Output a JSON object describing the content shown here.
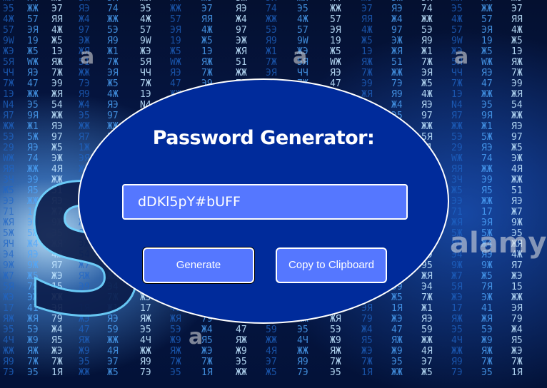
{
  "background": {
    "matrix_columns": [
      "ЖИ\nЭ5\n4Ж\n57\n9W\nЖЭ\n5Я\nЧЧ\n7Ж\n1Э\nN4\nЯ7\nЖЖ\n5Э\n29\nWЖ\nЯЯ\n3Ч\nЖ5\nЭЭ\n71\nЖЯ\n5Ж\nЯЧ\nЭ4\n9Ж\nЖ7\n5Я\nЖЭ\n17\nЯЖ\nЭ5\n4Ч\nЖЖ\nЯ9\n7Э",
      "Я4\nЖЖ\n57\nЭЯ\n19\nЖ5\nWЖ\nЯЭ\n47\nЖЖ\nЭ5\n9Я\nЖ1\n5Ж\nЯЭ\n74\nЖЖ\nЭ9\nЯ5\nЖЖ\n17\nЭЯ\n5Ж\nЖ4\nЯЭ\n9Ж\nЖ5\n7Я\nЭЖ\n41\nЖЯ\n5Э\nЖ9\nЯЖ\n7Ж\nЭ5",
      "Ж9\nЭ7\nЯЯ\n4Ж\nЖ5\n1Э\nЯЖ\n7Ж\nЭ9\nЖЯ\n54\nЖЖ\nЯЭ\n97\nЖ5\nЭЖ\n4Я\nЖЖ\n51\nЯЭ\nЖ7\n9Ж\nЭ5\nЖЯ\n4Ж\nЯ7\nЖЭ\n15\nЖЖ\nЭЯ\n79\nЖ4\nЯ5\nЖЭ\n7Ж\n1Я",
      "5Ж\nЯЭ\nЖ4\n97\nЭЖ\nЖЯ\n51\nЖЖ\n7Э\nЯ9\nЖ4\nЭ5\nЖЖ\nЯ7\n1Ж\nЭЯ\nЖ9\n45\nЖЖ\nЯЭ\n7Ж\nЖ1\n9Я\nЭЖ\n54\nЖ7\nЯЖ\nЭ9\nЖ5\n1Я\nЖЭ\n47\nЯЖ\nЖ9\nЭ5\nЖЖ",
      "ЭЯ\n74\nЖЖ\n5Э\nЯ9\nЖ1\n7Ж\nЭЯ\nЖ5\n4Ж\nЯЭ\n97\nЖЖ\n5Я\nЭ1\nЖ4\nЯЖ\n7Э\nЖ9\nЖ5\nЭЯ\n1Ж\n47\nЯЖ\nЖЭ\n95\nЖЯ\nЭ4\n7Ж\nЖ1\nЯЭ\n59\nЖЖ\n4Я\nЭ7\nЖ5"
    ],
    "big_letters": "SO",
    "watermarks": [
      "a",
      "a",
      "a",
      "alamy",
      "a"
    ]
  },
  "card": {
    "title": "Password Generator:",
    "password_value": "dDKl5pY#bUFF",
    "generate_label": "Generate",
    "copy_label": "Copy to Clipboard"
  }
}
